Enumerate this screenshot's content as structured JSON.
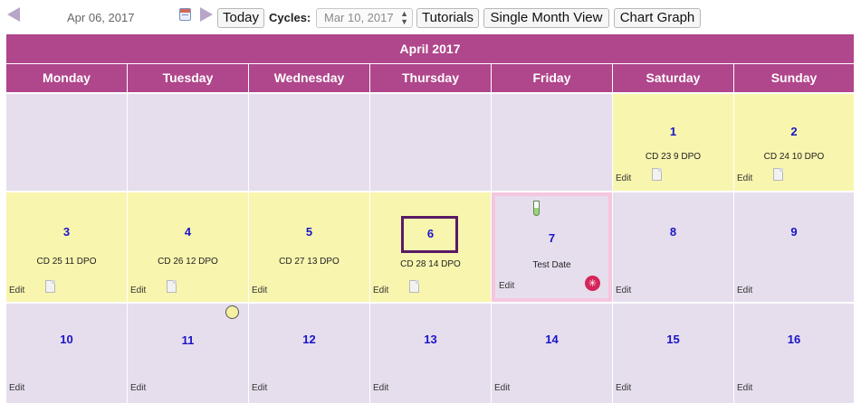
{
  "toolbar": {
    "current_date": "Apr 06, 2017",
    "today_label": "Today",
    "cycles_label": "Cycles:",
    "cycle_value": "Mar 10, 2017",
    "tutorials_label": "Tutorials",
    "single_month_label": "Single Month View",
    "chart_graph_label": "Chart Graph"
  },
  "calendar": {
    "month_title": "April 2017",
    "weekdays": [
      "Monday",
      "Tuesday",
      "Wednesday",
      "Thursday",
      "Friday",
      "Saturday",
      "Sunday"
    ],
    "edit_label": "Edit",
    "days": {
      "d1": {
        "num": "1",
        "info": "CD 23 9 DPO"
      },
      "d2": {
        "num": "2",
        "info": "CD 24 10 DPO"
      },
      "d3": {
        "num": "3",
        "info": "CD 25 11 DPO"
      },
      "d4": {
        "num": "4",
        "info": "CD 26 12 DPO"
      },
      "d5": {
        "num": "5",
        "info": "CD 27 13 DPO"
      },
      "d6": {
        "num": "6",
        "info": "CD 28 14 DPO"
      },
      "d7": {
        "num": "7",
        "info": "Test Date"
      },
      "d8": {
        "num": "8"
      },
      "d9": {
        "num": "9"
      },
      "d10": {
        "num": "10"
      },
      "d11": {
        "num": "11"
      },
      "d12": {
        "num": "12"
      },
      "d13": {
        "num": "13"
      },
      "d14": {
        "num": "14"
      },
      "d15": {
        "num": "15"
      },
      "d16": {
        "num": "16"
      }
    }
  },
  "colors": {
    "header": "#b0468b",
    "highlight_cell": "#f8f5ae",
    "normal_cell": "#e6deed",
    "day_number": "#1a14c8",
    "test_date_border": "#f4c6df"
  },
  "icons": [
    "prev-arrow-icon",
    "calendar-icon",
    "next-arrow-icon",
    "note-icon",
    "circle-icon",
    "test-tube-icon",
    "test-result-icon"
  ]
}
